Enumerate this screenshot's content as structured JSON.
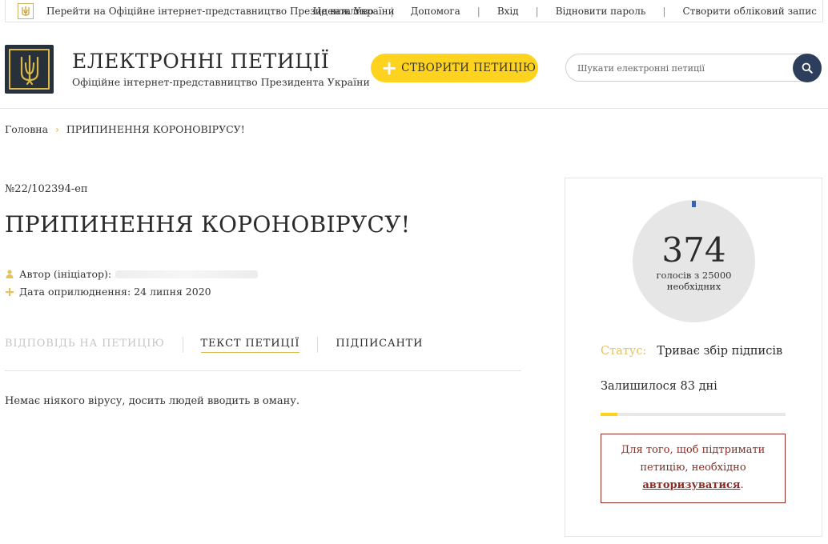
{
  "topbar": {
    "portal_link": "Перейти на Офіційне інтернет-представництво Президента України",
    "nav": [
      "Це важливо",
      "Допомога",
      "Вхід",
      "Відновити пароль",
      "Створити обліковий запис"
    ]
  },
  "header": {
    "title": "ЕЛЕКТРОННІ ПЕТИЦІЇ",
    "subtitle": "Офіційне інтернет-представництво Президента України",
    "create_button": "СТВОРИТИ ПЕТИЦІЮ",
    "search_placeholder": "Шукати електронні петиції"
  },
  "breadcrumb": {
    "home": "Головна",
    "current": "ПРИПИНЕННЯ КОРОНОВІРУСУ!"
  },
  "petition": {
    "number": "№22/102394-еп",
    "title": "ПРИПИНЕННЯ КОРОНОВІРУСУ!",
    "author_label": "Автор (ініціатор):",
    "date_label": "Дата оприлюднення: 24 липня 2020",
    "text": "Немає ніякого вірусу, досить людей вводить в оману."
  },
  "tabs": {
    "response": "ВІДПОВІДЬ НА ПЕТИЦІЮ",
    "text": "ТЕКСТ ПЕТИЦІЇ",
    "signers": "ПІДПИСАНТИ"
  },
  "sidebar": {
    "votes": "374",
    "votes_needed": "голосів з 25000 необхідних",
    "votes_target": 25000,
    "status_label": "Статус:",
    "status_value": "Триває збір підписів",
    "days_left": "Залишилося 83 дні",
    "progress_fraction": 0.09,
    "auth_text_before": "Для того, щоб підтримати петицію, необхідно",
    "auth_link": "авторизуватися",
    "auth_text_after": "."
  },
  "colors": {
    "accent_yellow": "#fed320",
    "gold": "#d9b84a",
    "navy": "#2c3e5c",
    "warning": "#8e2a22"
  }
}
